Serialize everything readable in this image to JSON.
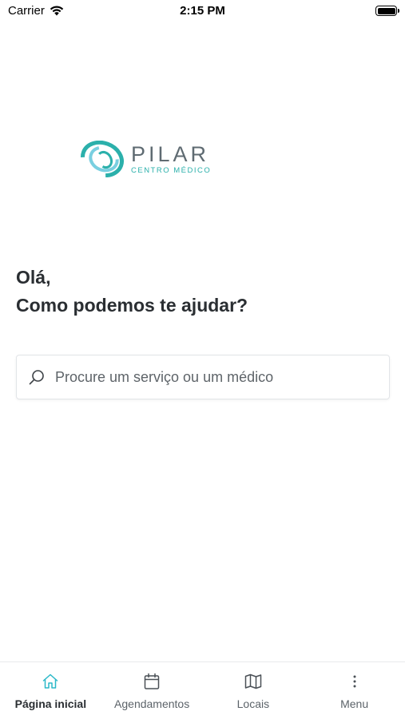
{
  "status_bar": {
    "carrier": "Carrier",
    "time": "2:15 PM"
  },
  "logo": {
    "name": "PILAR",
    "subtitle": "CENTRO MÉDICO"
  },
  "greeting": {
    "line1": "Olá,",
    "line2": "Como podemos te ajudar?"
  },
  "search": {
    "placeholder": "Procure um serviço ou um médico",
    "value": ""
  },
  "tab_bar": {
    "items": [
      {
        "label": "Página inicial",
        "icon": "home-icon",
        "active": true
      },
      {
        "label": "Agendamentos",
        "icon": "calendar-icon",
        "active": false
      },
      {
        "label": "Locais",
        "icon": "map-icon",
        "active": false
      },
      {
        "label": "Menu",
        "icon": "more-vertical-icon",
        "active": false
      }
    ]
  },
  "colors": {
    "accent": "#2bb0ab",
    "text": "#2a2e32",
    "muted": "#5c6369"
  }
}
